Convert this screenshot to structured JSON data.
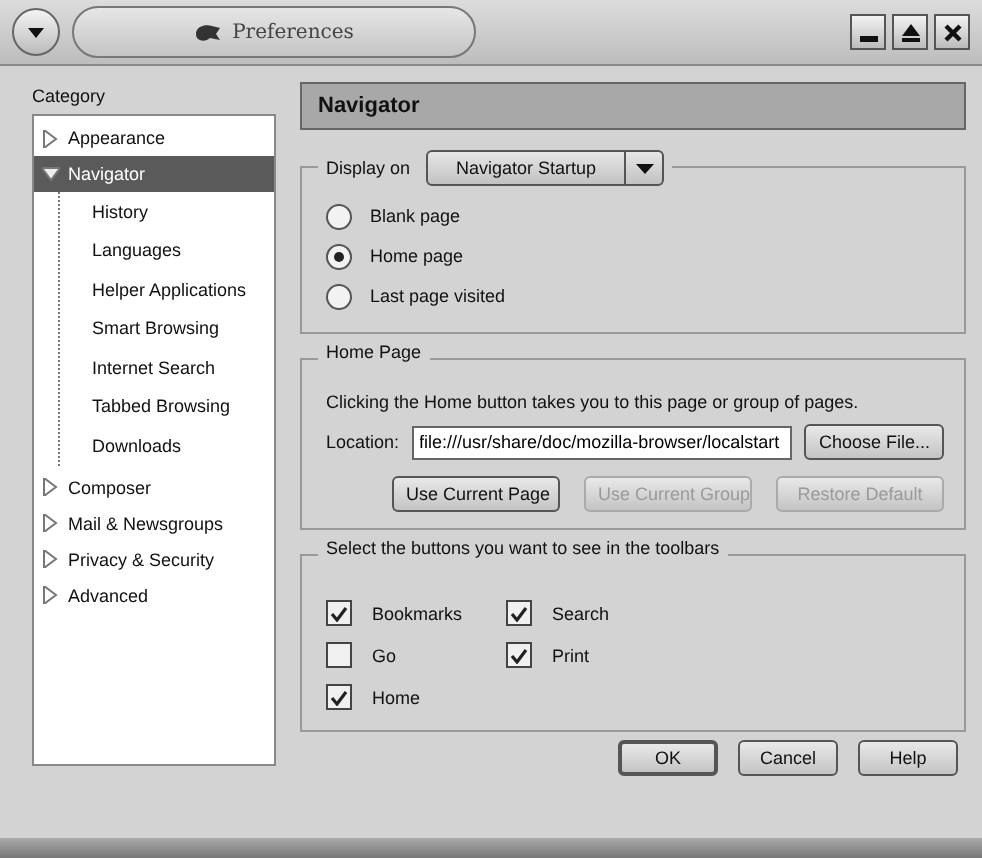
{
  "window": {
    "title": "Preferences"
  },
  "sidebar": {
    "label": "Category",
    "items": [
      {
        "label": "Appearance",
        "expanded": false,
        "selected": false
      },
      {
        "label": "Navigator",
        "expanded": true,
        "selected": true,
        "children": [
          {
            "label": "History",
            "selected": false
          },
          {
            "label": "Languages",
            "selected": false
          },
          {
            "label": "Helper Applications",
            "selected": false
          },
          {
            "label": "Smart Browsing",
            "selected": false
          },
          {
            "label": "Internet Search",
            "selected": false
          },
          {
            "label": "Tabbed Browsing",
            "selected": false
          },
          {
            "label": "Downloads",
            "selected": false
          }
        ]
      },
      {
        "label": "Composer",
        "expanded": false,
        "selected": false
      },
      {
        "label": "Mail & Newsgroups",
        "expanded": false,
        "selected": false
      },
      {
        "label": "Privacy & Security",
        "expanded": false,
        "selected": false
      },
      {
        "label": "Advanced",
        "expanded": false,
        "selected": false
      }
    ]
  },
  "panel": {
    "title": "Navigator",
    "display_on": {
      "label": "Display on",
      "value": "Navigator Startup",
      "options": [
        {
          "label": "Blank page",
          "selected": false
        },
        {
          "label": "Home page",
          "selected": true
        },
        {
          "label": "Last page visited",
          "selected": false
        }
      ]
    },
    "home_page": {
      "legend": "Home Page",
      "description": "Clicking the Home button takes you to this page or group of pages.",
      "location_label": "Location:",
      "location": "file:///usr/share/doc/mozilla-browser/localstart",
      "choose": "Choose File...",
      "buttons": [
        {
          "label": "Use Current Page",
          "disabled": false
        },
        {
          "label": "Use Current Group",
          "disabled": true
        },
        {
          "label": "Restore Default",
          "disabled": true
        }
      ]
    },
    "toolbar": {
      "legend": "Select the buttons you want to see in the toolbars",
      "columns": [
        [
          {
            "label": "Bookmarks",
            "checked": true
          },
          {
            "label": "Go",
            "checked": false
          },
          {
            "label": "Home",
            "checked": true
          }
        ],
        [
          {
            "label": "Search",
            "checked": true
          },
          {
            "label": "Print",
            "checked": true
          }
        ]
      ]
    }
  },
  "buttons": [
    {
      "label": "OK",
      "default": true
    },
    {
      "label": "Cancel",
      "default": false
    },
    {
      "label": "Help",
      "default": false
    }
  ]
}
